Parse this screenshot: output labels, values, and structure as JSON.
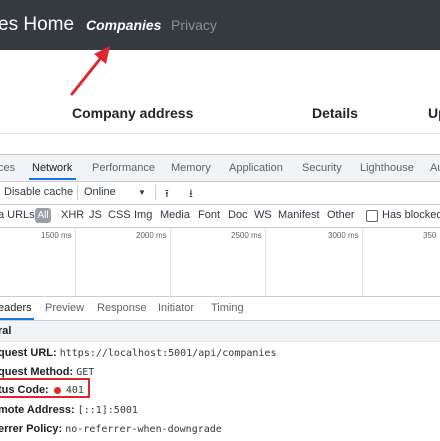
{
  "navbar": {
    "brand": "es Home",
    "links": {
      "companies": "Companies",
      "privacy": "Privacy"
    }
  },
  "table": {
    "headers": [
      "Company address",
      "Details",
      "Up"
    ]
  },
  "devtools": {
    "tabs": [
      "ces",
      "Network",
      "Performance",
      "Memory",
      "Application",
      "Security",
      "Lighthouse",
      "Au"
    ],
    "active_tab": "Network",
    "toolbar": {
      "disable_cache": "Disable cache",
      "throttle": "Online",
      "dropdown_glyph": "▼",
      "upload_glyph": "⭱",
      "download_glyph": "⭳"
    },
    "filters": {
      "data_urls": "a URLs",
      "all": "All",
      "types": [
        "XHR",
        "JS",
        "CSS",
        "Img",
        "Media",
        "Font",
        "Doc",
        "WS",
        "Manifest",
        "Other"
      ],
      "blocked": "Has blocked"
    },
    "timeline": {
      "labels": [
        "1500 ms",
        "2000 ms",
        "2500 ms",
        "3000 ms",
        "350"
      ]
    },
    "detail_tabs": [
      "eaders",
      "Preview",
      "Response",
      "Initiator",
      "Timing"
    ],
    "active_detail_tab": "eaders",
    "general": {
      "title": "ral",
      "rows": [
        {
          "key": "quest URL:",
          "value": "https://localhost:5001/api/companies"
        },
        {
          "key": "quest Method:",
          "value": "GET"
        },
        {
          "key": "tus Code:",
          "value": "401"
        },
        {
          "key": "mote Address:",
          "value": "[::1]:5001"
        },
        {
          "key": "errer Policy:",
          "value": "no-referrer-when-downgrade"
        }
      ]
    }
  },
  "colors": {
    "navbar_bg": "#343a40",
    "annotation_red": "#e0262d",
    "status_dot": "#d93025",
    "devtools_accent": "#1a73e8"
  }
}
